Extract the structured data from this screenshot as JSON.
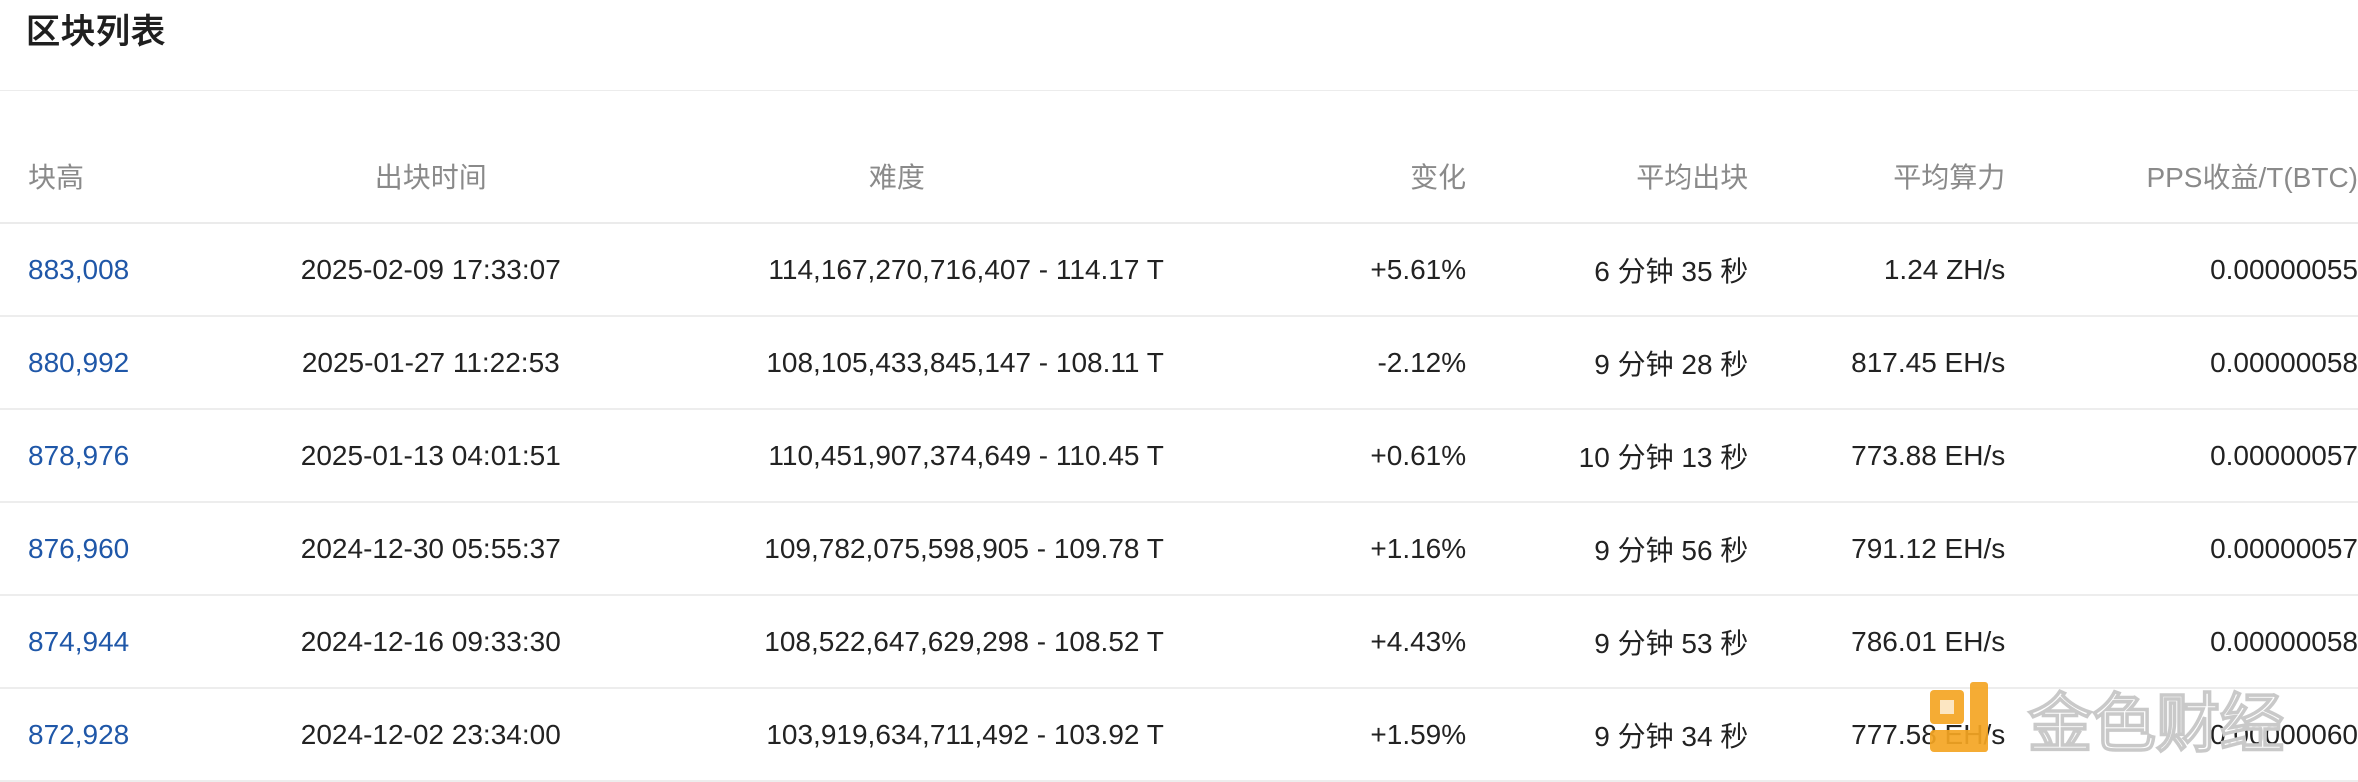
{
  "page": {
    "title": "区块列表"
  },
  "table": {
    "columns": [
      {
        "key": "height",
        "label": "块高"
      },
      {
        "key": "time",
        "label": "出块时间"
      },
      {
        "key": "difficulty",
        "label": "难度"
      },
      {
        "key": "change",
        "label": "变化"
      },
      {
        "key": "avg_block_time",
        "label": "平均出块"
      },
      {
        "key": "avg_hashrate",
        "label": "平均算力"
      },
      {
        "key": "pps",
        "label": "PPS收益/T(BTC)"
      }
    ],
    "rows": [
      {
        "height": "883,008",
        "time": "2025-02-09 17:33:07",
        "difficulty": "114,167,270,716,407 - 114.17 T",
        "change": "+5.61%",
        "avg_block_time": "6 分钟 35 秒",
        "avg_hashrate": "1.24 ZH/s",
        "pps": "0.00000055"
      },
      {
        "height": "880,992",
        "time": "2025-01-27 11:22:53",
        "difficulty": "108,105,433,845,147 - 108.11 T",
        "change": "-2.12%",
        "avg_block_time": "9 分钟 28 秒",
        "avg_hashrate": "817.45 EH/s",
        "pps": "0.00000058"
      },
      {
        "height": "878,976",
        "time": "2025-01-13 04:01:51",
        "difficulty": "110,451,907,374,649 - 110.45 T",
        "change": "+0.61%",
        "avg_block_time": "10 分钟 13 秒",
        "avg_hashrate": "773.88 EH/s",
        "pps": "0.00000057"
      },
      {
        "height": "876,960",
        "time": "2024-12-30 05:55:37",
        "difficulty": "109,782,075,598,905 - 109.78 T",
        "change": "+1.16%",
        "avg_block_time": "9 分钟 56 秒",
        "avg_hashrate": "791.12 EH/s",
        "pps": "0.00000057"
      },
      {
        "height": "874,944",
        "time": "2024-12-16 09:33:30",
        "difficulty": "108,522,647,629,298 - 108.52 T",
        "change": "+4.43%",
        "avg_block_time": "9 分钟 53 秒",
        "avg_hashrate": "786.01 EH/s",
        "pps": "0.00000058"
      },
      {
        "height": "872,928",
        "time": "2024-12-02 23:34:00",
        "difficulty": "103,919,634,711,492 - 103.92 T",
        "change": "+1.59%",
        "avg_block_time": "9 分钟 34 秒",
        "avg_hashrate": "777.58 EH/s",
        "pps": "0.00000060"
      }
    ]
  },
  "colors": {
    "link": "#1f57a8",
    "positive": "#3aa05a",
    "negative": "#e0413a",
    "header_text": "#8a8a8a",
    "watermark_accent": "#f5a623"
  },
  "watermark": {
    "text": "金色财经",
    "icon": "jinse-logo-icon"
  }
}
